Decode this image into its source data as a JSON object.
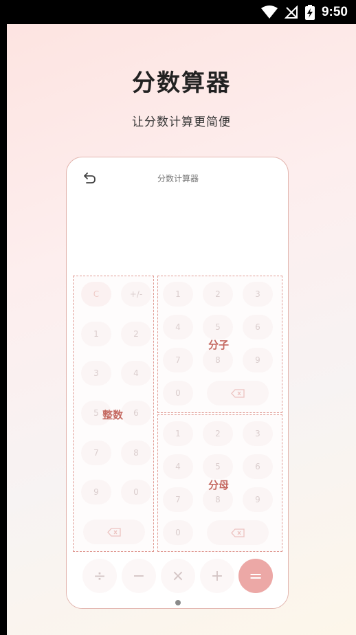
{
  "status_bar": {
    "time": "9:50"
  },
  "header": {
    "title": "分数算器",
    "subtitle": "让分数计算更简便"
  },
  "calculator": {
    "title": "分数计算器",
    "integer_keys": {
      "clear": "C",
      "sign": "+/-",
      "k1": "1",
      "k2": "2",
      "k3": "3",
      "k4": "4",
      "k5": "5",
      "k6": "6",
      "k7": "7",
      "k8": "8",
      "k9": "9",
      "k0": "0"
    },
    "numerator_keys": {
      "k1": "1",
      "k2": "2",
      "k3": "3",
      "k4": "4",
      "k5": "5",
      "k6": "6",
      "k7": "7",
      "k8": "8",
      "k9": "9",
      "k0": "0"
    },
    "denominator_keys": {
      "k1": "1",
      "k2": "2",
      "k3": "3",
      "k4": "4",
      "k5": "5",
      "k6": "6",
      "k7": "7",
      "k8": "8",
      "k9": "9",
      "k0": "0"
    },
    "operators": {
      "divide": "÷",
      "minus": "−",
      "multiply": "×",
      "plus": "+",
      "equals": "="
    },
    "regions": {
      "integer": "整数",
      "numerator": "分子",
      "denominator": "分母"
    }
  },
  "icons": {
    "back": "undo-arrow-icon",
    "backspace": "backspace-icon",
    "wifi": "wifi-icon",
    "signal": "no-signal-icon",
    "battery": "battery-charging-icon"
  },
  "colors": {
    "accent": "#eca8a6",
    "dashed_border": "#e09a93",
    "region_label": "#c56a62"
  }
}
